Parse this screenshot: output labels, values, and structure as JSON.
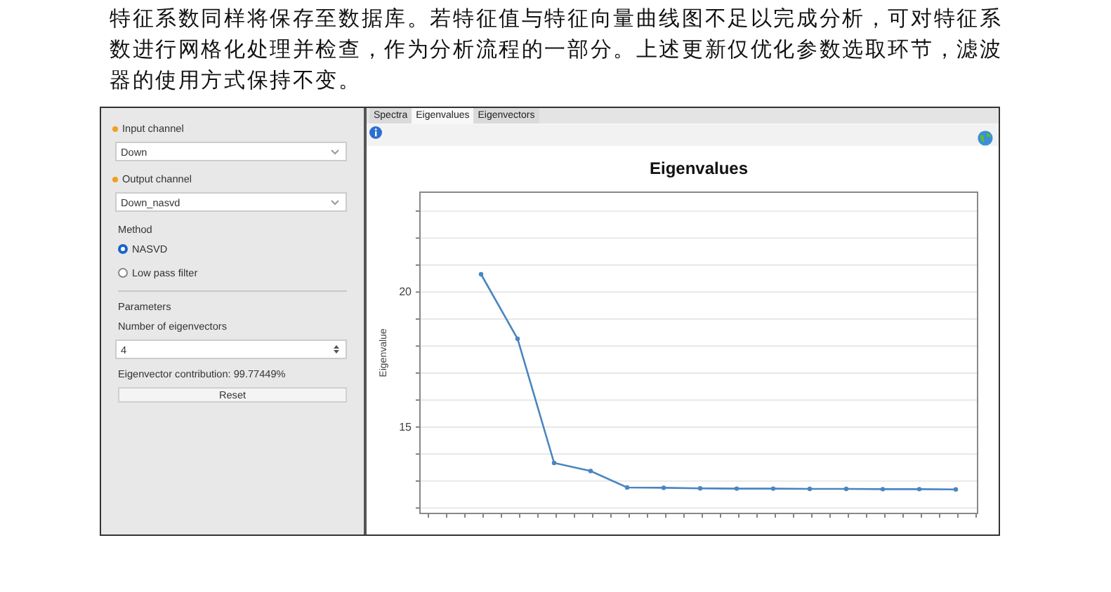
{
  "paragraph": "特征系数同样将保存至数据库。若特征值与特征向量曲线图不足以完成分析，可对特征系数进行网格化处理并检查，作为分析流程的一部分。上述更新仅优化参数选取环节，滤波器的使用方式保持不变。",
  "left_panel": {
    "input_channel": {
      "label": "Input channel",
      "required": true,
      "value": "Down"
    },
    "output_channel": {
      "label": "Output channel",
      "required": true,
      "value": "Down_nasvd"
    },
    "method": {
      "label": "Method",
      "options": [
        {
          "label": "NASVD",
          "selected": true
        },
        {
          "label": "Low pass filter",
          "selected": false
        }
      ]
    },
    "parameters": {
      "label": "Parameters",
      "count_label": "Number of eigenvectors",
      "count_value": "4",
      "contribution": "Eigenvector contribution: 99.77449%",
      "reset": "Reset"
    }
  },
  "tabs": [
    {
      "label": "Spectra",
      "selected": false
    },
    {
      "label": "Eigenvalues",
      "selected": true
    },
    {
      "label": "Eigenvectors",
      "selected": false
    }
  ],
  "chart": {
    "chart_data": {
      "type": "line",
      "title": "Eigenvalues",
      "ylabel": "Eigenvalue",
      "categories": [
        null,
        null,
        null,
        null,
        null,
        null,
        null,
        null,
        null,
        null,
        null,
        null,
        null,
        null,
        null
      ],
      "series": [
        {
          "color": "#4a86c0",
          "marker": true,
          "values": [
            null,
            20.66,
            18.27,
            13.67,
            13.37,
            12.76,
            12.75,
            12.73,
            12.72,
            12.72,
            12.71,
            12.71,
            12.7,
            12.7,
            12.69
          ]
        }
      ],
      "ylim": [
        11.8,
        23.7
      ],
      "yticks": [
        15,
        20
      ]
    }
  }
}
